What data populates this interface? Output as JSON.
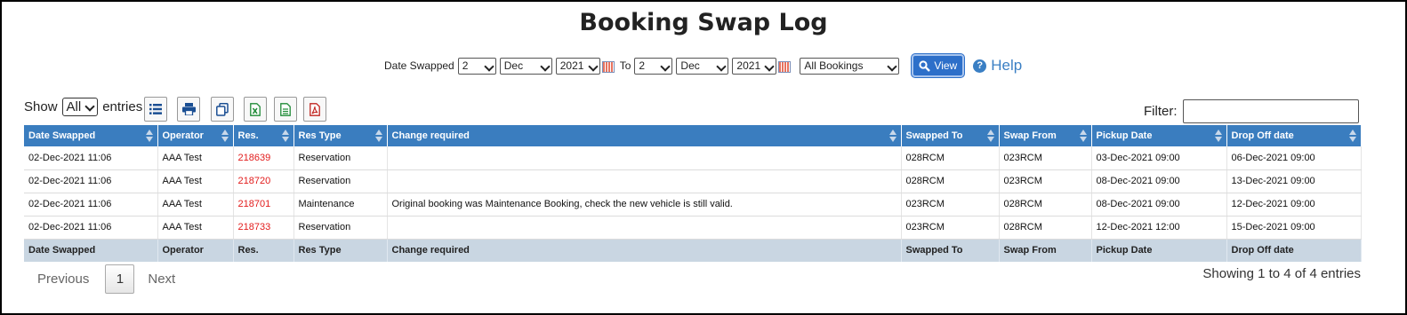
{
  "title": "Booking Swap Log",
  "criteria": {
    "date_swapped_label": "Date Swapped",
    "from_day": "2",
    "from_month": "Dec",
    "from_year": "2021",
    "to_label": "To",
    "to_day": "2",
    "to_month": "Dec",
    "to_year": "2021",
    "booking_filter": "All Bookings",
    "view_label": "View",
    "help_label": "Help"
  },
  "length": {
    "show_label": "Show",
    "value": "All",
    "entries_label": "entries"
  },
  "filter_label": "Filter:",
  "table": {
    "columns": [
      "Date Swapped",
      "Operator",
      "Res.",
      "Res Type",
      "Change required",
      "Swapped To",
      "Swap From",
      "Pickup Date",
      "Drop Off date"
    ],
    "footer_columns": [
      "Date Swapped",
      "Operator",
      "Res.",
      "Res Type",
      "Change required",
      "Swapped To",
      "Swap From",
      "Pickup Date",
      "Drop Off date"
    ],
    "rows": [
      [
        "02-Dec-2021 11:06",
        "AAA Test",
        "218639",
        "Reservation",
        "",
        "028RCM",
        "023RCM",
        "03-Dec-2021 09:00",
        "06-Dec-2021 09:00"
      ],
      [
        "02-Dec-2021 11:06",
        "AAA Test",
        "218720",
        "Reservation",
        "",
        "028RCM",
        "023RCM",
        "08-Dec-2021 09:00",
        "13-Dec-2021 09:00"
      ],
      [
        "02-Dec-2021 11:06",
        "AAA Test",
        "218701",
        "Maintenance",
        "Original booking was Maintenance Booking, check the new vehicle is still valid.",
        "023RCM",
        "028RCM",
        "08-Dec-2021 09:00",
        "12-Dec-2021 09:00"
      ],
      [
        "02-Dec-2021 11:06",
        "AAA Test",
        "218733",
        "Reservation",
        "",
        "023RCM",
        "028RCM",
        "12-Dec-2021 12:00",
        "15-Dec-2021 09:00"
      ]
    ]
  },
  "pagination": {
    "previous": "Previous",
    "current": "1",
    "next": "Next"
  },
  "info": "Showing 1 to 4 of 4 entries",
  "colors": {
    "header": "#3a7dbf",
    "footer": "#c9d6e2",
    "res_link": "#e21b1b",
    "view_button": "#2d6fc9"
  }
}
